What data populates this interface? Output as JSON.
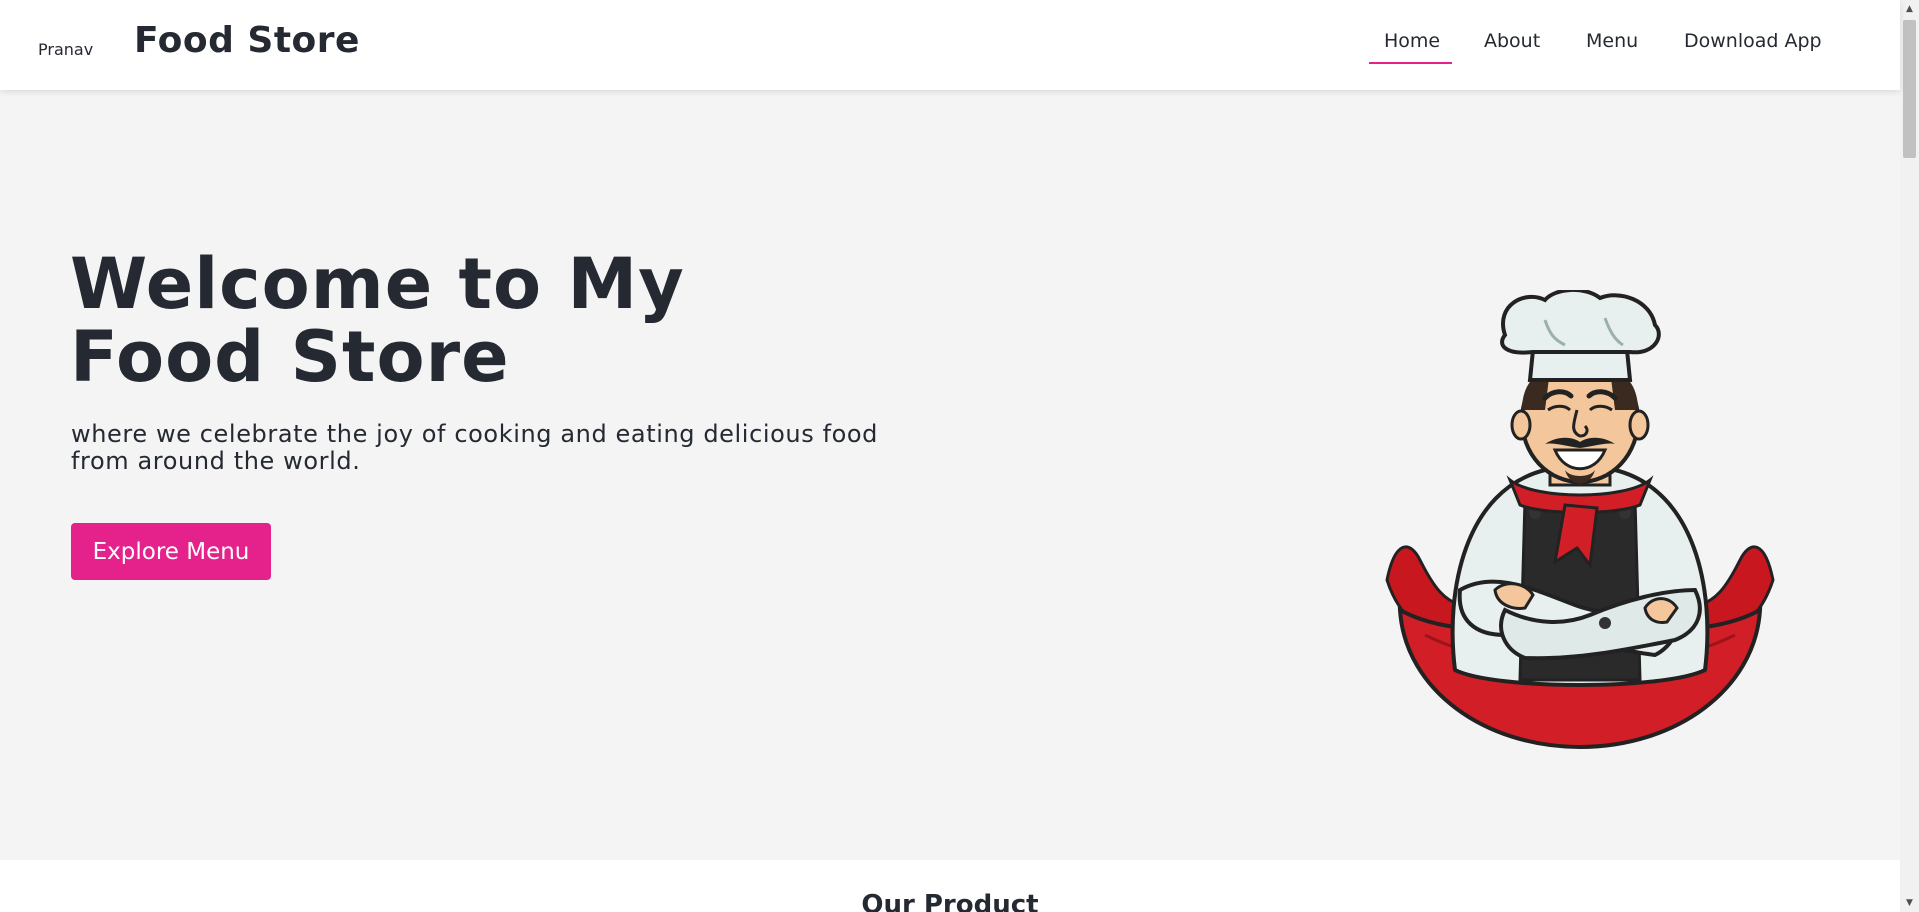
{
  "header": {
    "brand_small": "Pranav",
    "brand": "Food Store",
    "nav": [
      {
        "label": "Home",
        "active": true
      },
      {
        "label": "About"
      },
      {
        "label": "Menu"
      },
      {
        "label": "Download App"
      }
    ],
    "accent_color": "#e5218b"
  },
  "hero": {
    "title": "Welcome to My Food Store",
    "subtitle": "where we celebrate the joy of cooking and eating delicious food from around the world.",
    "cta_label": "Explore Menu",
    "image": "chef-mascot-illustration"
  },
  "products": {
    "title": "Our Product"
  },
  "scrollbar": {
    "up_icon": "chevron-up-icon",
    "down_icon": "chevron-down-icon"
  }
}
